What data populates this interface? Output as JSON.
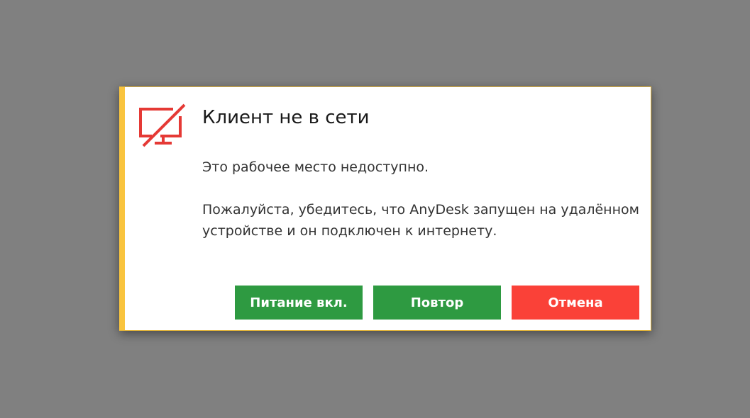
{
  "dialog": {
    "title": "Клиент не в сети",
    "icon": "monitor-offline-icon",
    "line1": "Это рабочее место недоступно.",
    "line2": "Пожалуйста, убедитесь, что AnyDesk запущен на удалённом устройстве и он подключен к интернету.",
    "buttons": {
      "power_on": "Питание вкл.",
      "retry": "Повтор",
      "cancel": "Отмена"
    }
  },
  "colors": {
    "accent": "#f9c43e",
    "icon": "#e53935",
    "success": "#2e9a41",
    "danger": "#fa4138",
    "overlay": "#808080"
  }
}
